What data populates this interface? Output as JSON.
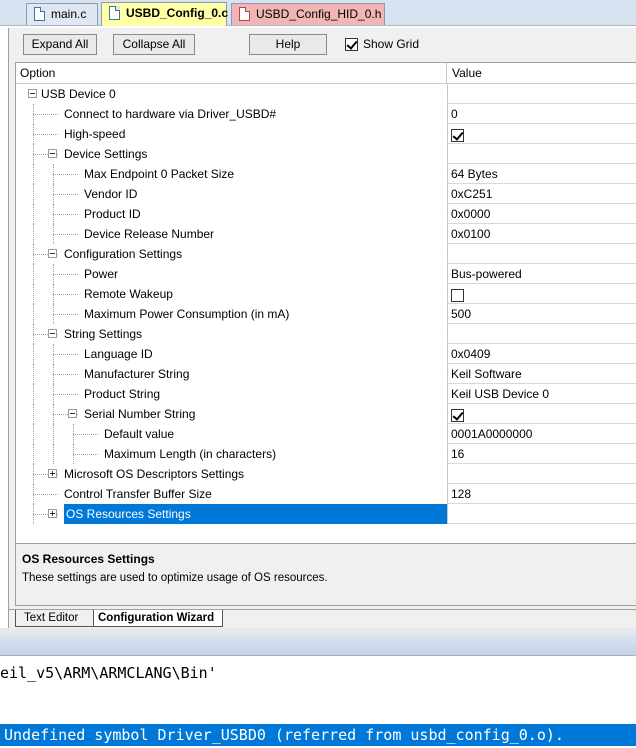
{
  "file_tabs": [
    {
      "label": "main.c"
    },
    {
      "label": "USBD_Config_0.c"
    },
    {
      "label": "USBD_Config_HID_0.h"
    }
  ],
  "toolbar": {
    "expand_all": "Expand All",
    "collapse_all": "Collapse All",
    "help": "Help",
    "show_grid": "Show Grid",
    "show_grid_checked": true
  },
  "grid": {
    "col_option": "Option",
    "col_value": "Value"
  },
  "tree": [
    {
      "label": "USB Device 0",
      "value": "",
      "level": 0,
      "expander": "minus"
    },
    {
      "label": "Connect to hardware via Driver_USBD#",
      "value": "0",
      "level": 1
    },
    {
      "label": "High-speed",
      "value": "",
      "checkbox": true,
      "checked": true,
      "level": 1
    },
    {
      "label": "Device Settings",
      "value": "",
      "level": 1,
      "expander": "minus"
    },
    {
      "label": "Max Endpoint 0 Packet Size",
      "value": "64 Bytes",
      "level": 2
    },
    {
      "label": "Vendor ID",
      "value": "0xC251",
      "level": 2
    },
    {
      "label": "Product ID",
      "value": "0x0000",
      "level": 2
    },
    {
      "label": "Device Release Number",
      "value": "0x0100",
      "level": 2
    },
    {
      "label": "Configuration Settings",
      "value": "",
      "level": 1,
      "expander": "minus"
    },
    {
      "label": "Power",
      "value": "Bus-powered",
      "level": 2
    },
    {
      "label": "Remote Wakeup",
      "value": "",
      "checkbox": true,
      "checked": false,
      "level": 2
    },
    {
      "label": "Maximum Power Consumption (in mA)",
      "value": "500",
      "level": 2
    },
    {
      "label": "String Settings",
      "value": "",
      "level": 1,
      "expander": "minus"
    },
    {
      "label": "Language ID",
      "value": "0x0409",
      "level": 2
    },
    {
      "label": "Manufacturer String",
      "value": "Keil Software",
      "level": 2
    },
    {
      "label": "Product String",
      "value": "Keil USB Device 0",
      "level": 2
    },
    {
      "label": "Serial Number String",
      "value": "",
      "checkbox": true,
      "checked": true,
      "level": 2,
      "expander": "minus"
    },
    {
      "label": "Default value",
      "value": "0001A0000000",
      "level": 3
    },
    {
      "label": "Maximum Length (in characters)",
      "value": "16",
      "level": 3
    },
    {
      "label": "Microsoft OS Descriptors Settings",
      "value": "",
      "level": 1,
      "expander": "plus"
    },
    {
      "label": "Control Transfer Buffer Size",
      "value": "128",
      "level": 1
    },
    {
      "label": "OS Resources Settings",
      "value": "",
      "level": 1,
      "expander": "plus",
      "selected": true
    }
  ],
  "description": {
    "title": "OS Resources Settings",
    "text": "These settings are used to optimize usage of OS resources."
  },
  "editor_tabs": [
    {
      "label": "Text Editor"
    },
    {
      "label": "Configuration Wizard"
    }
  ],
  "output": {
    "line1": "eil_v5\\ARM\\ARMCLANG\\Bin'",
    "line2": "Undefined symbol Driver_USBD0 (referred from usbd_config_0.o)."
  },
  "colors": {
    "selection": "#0078d7",
    "active_tab": "#ffffa8",
    "header_tab": "#f2b5b5"
  }
}
